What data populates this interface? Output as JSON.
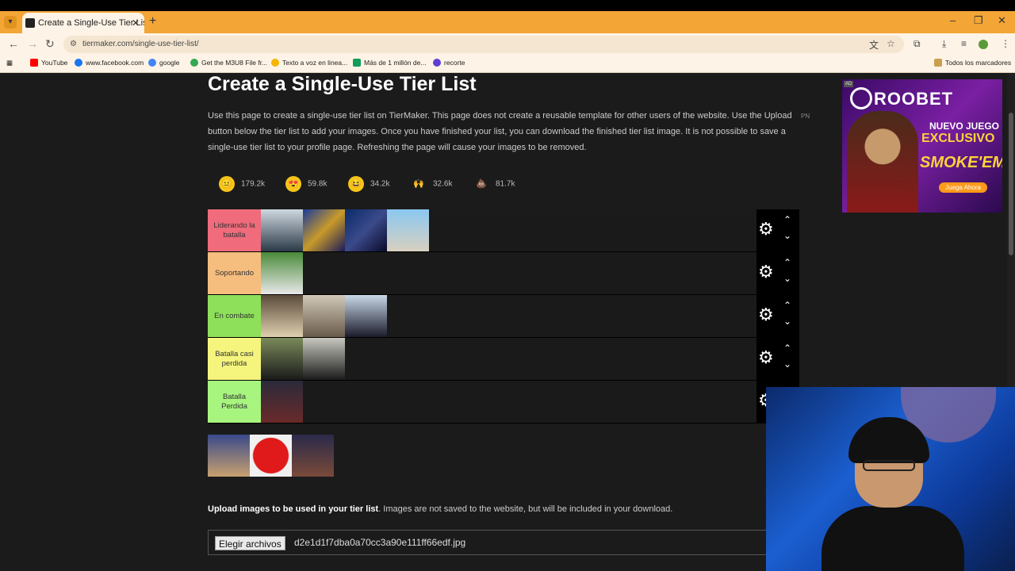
{
  "browser": {
    "tab_title": "Create a Single-Use Tier List (Fi",
    "tab_close": "✕",
    "new_tab": "+",
    "url": "tiermaker.com/single-use-tier-list/",
    "bookmarks": [
      {
        "label": "YouTube",
        "color": "#ff0000"
      },
      {
        "label": "www.facebook.com",
        "color": "#1877f2"
      },
      {
        "label": "google",
        "color": "#4285f4"
      },
      {
        "label": "Get the M3U8 File fr...",
        "color": "#34a853"
      },
      {
        "label": "Texto a voz en linea...",
        "color": "#f4b400"
      },
      {
        "label": "Más de 1 millón de...",
        "color": "#0f9d58"
      },
      {
        "label": "recorte",
        "color": "#5b3fd6"
      }
    ],
    "all_bookmarks": "Todos los marcadores"
  },
  "page": {
    "title": "Create a Single-Use Tier List",
    "description": "Use this page to create a single-use tier list on TierMaker. This page does not create a reusable template for other users of the website. Use the Upload button below the tier list to add your images. Once you have finished your list, you can download the finished tier list image. It is not possible to save a single-use tier list to your profile page. Refreshing the page will cause your images to be removed.",
    "pn": "PN"
  },
  "reactions": [
    {
      "icon": "neutral-face-icon",
      "count": "179.2k",
      "color": "#f5c518"
    },
    {
      "icon": "heart-eyes-icon",
      "count": "59.8k",
      "color": "#f5c518"
    },
    {
      "icon": "laughing-face-icon",
      "count": "34.2k",
      "color": "#f5c518"
    },
    {
      "icon": "raised-hands-icon",
      "count": "32.6k",
      "color": "#f5c518"
    },
    {
      "icon": "poop-icon",
      "count": "81.7k",
      "color": "#8b5a2b"
    }
  ],
  "tiers": [
    {
      "label": "Liderando la batalla",
      "color": "#f06b7c",
      "items": 4
    },
    {
      "label": "Soportando",
      "color": "#f5bd7e",
      "items": 1
    },
    {
      "label": "En combate",
      "color": "#8ee05a",
      "items": 3
    },
    {
      "label": "Batalla casi perdida",
      "color": "#f5f57e",
      "items": 2
    },
    {
      "label": "Batalla Perdida",
      "color": "#a7f57e",
      "items": 1
    }
  ],
  "pool_items": 3,
  "upload": {
    "label_bold": "Upload images to be used in your tier list",
    "label_rest": ". Images are not saved to the website, but will be included in your download.",
    "button": "Elegir archivos",
    "filename": "d2e1d1f7dba0a70cc3a90e111ff66edf.jpg"
  },
  "ad": {
    "tag": "AD",
    "brand": "ROOBET",
    "line1": "NUEVO JUEGO",
    "line2": "EXCLUSIVO",
    "line3": "SMOKE'EM",
    "cta": "Juega Ahora"
  }
}
